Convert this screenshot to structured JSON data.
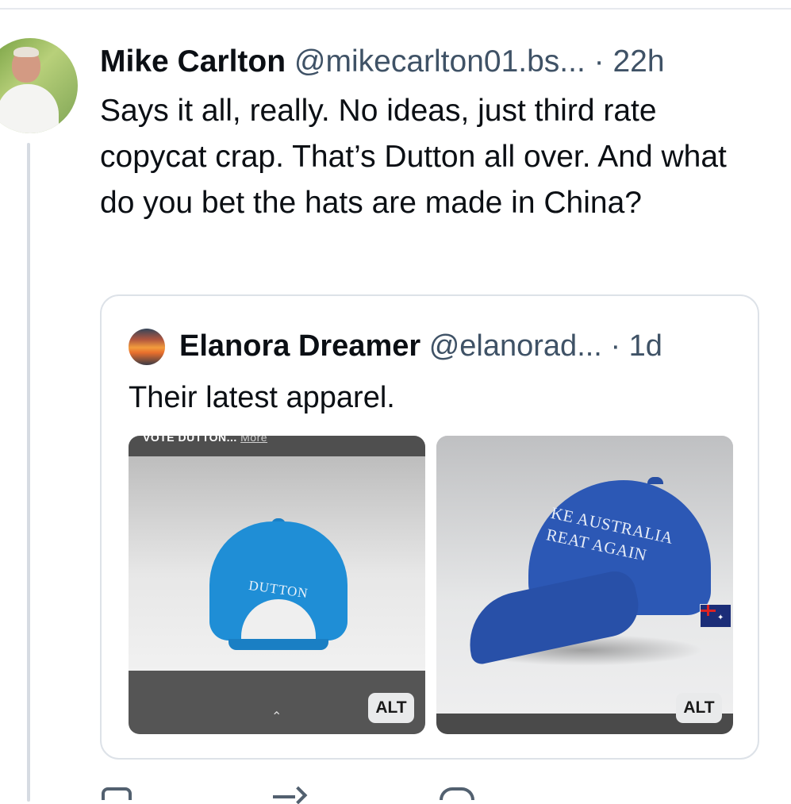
{
  "post": {
    "author": "Mike Carlton",
    "handle": "@mikecarlton01.bs...",
    "separator": "·",
    "time": "22h",
    "text": "Says it all, really. No ideas, just third rate copycat crap. That’s Dutton all over. And what do you bet the hats are made in China?"
  },
  "quote": {
    "author": "Elanora Dreamer",
    "handle": "@elanorad...",
    "separator": "·",
    "time": "1d",
    "text": "Their latest apparel.",
    "images": [
      {
        "caption": "VOTE DUTTON...",
        "more_label": "More",
        "cap_text": "DUTTON",
        "alt_label": "ALT"
      },
      {
        "cap_text_line1": "KE AUSTRALIA",
        "cap_text_line2": "REAT AGAIN",
        "alt_label": "ALT"
      }
    ]
  },
  "colors": {
    "text": "#0b0f14",
    "muted": "#3f5266",
    "border": "#dde2e8",
    "thread_line": "#d6dbe2"
  }
}
